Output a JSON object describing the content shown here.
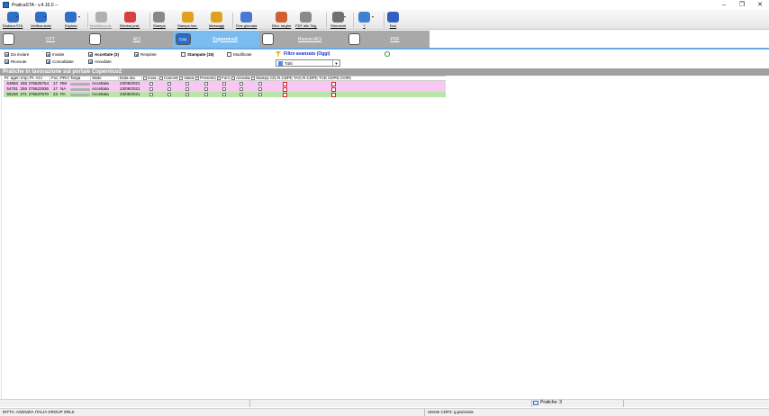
{
  "window": {
    "title": "PraticaSTA - v.4.16.0 --",
    "controls": [
      "–",
      "❐",
      "✕"
    ]
  },
  "toolbar": {
    "buttons": [
      {
        "label": "Elabora STA",
        "icon": "elabora-icon",
        "color": "#2e6fc8",
        "dropdown": true
      },
      {
        "label": "Verifica stato",
        "icon": "verifica-icon",
        "color": "#2e6fc8",
        "dropdown": true
      },
      {
        "label": "Esplora",
        "icon": "esplora-icon",
        "color": "#2e6fc8",
        "dropdown": true
      },
      {
        "label": "Modifica prat.",
        "icon": "modifica-icon",
        "color": "#b0b0b0",
        "disabled": true
      },
      {
        "label": "Elimina prat.",
        "icon": "elimina-icon",
        "color": "#d84040"
      },
      {
        "label": "Stampa",
        "icon": "stampa-icon",
        "color": "#888888"
      },
      {
        "label": "Stampa Ism.",
        "icon": "stampa-ism-icon",
        "color": "#e0a020"
      },
      {
        "label": "Messaggi",
        "icon": "messaggi-icon",
        "color": "#e0a020"
      },
      {
        "label": "Fine giornata",
        "icon": "fine-giornata-icon",
        "color": "#4a7ad0"
      },
      {
        "label": "Elim. targhe",
        "icon": "elim-targhe-icon",
        "color": "#d06030"
      },
      {
        "label": "PDF alle Tag.",
        "icon": "pdf-icon",
        "color": "#8a8a8a"
      },
      {
        "label": "Strumenti",
        "icon": "strumenti-icon",
        "color": "#707070",
        "dropdown": true
      },
      {
        "label": "?",
        "icon": "help-icon",
        "color": "#4080d0",
        "dropdown": true
      },
      {
        "label": "Esci",
        "icon": "exit-icon",
        "color": "#3060c0"
      }
    ]
  },
  "tabs": [
    {
      "label": "DTT",
      "short": "DT"
    },
    {
      "label": "ACI",
      "short": "ACI"
    },
    {
      "label": "Copernico2",
      "short": "Cop.",
      "active": true
    },
    {
      "label": "Rinnovi ACI",
      "short": "RA"
    },
    {
      "label": "PNF",
      "short": "P"
    }
  ],
  "filters": {
    "row1": [
      {
        "label": "Da inviare",
        "checked": true
      },
      {
        "label": "Inviate",
        "checked": true
      },
      {
        "label": "Accettate (3)",
        "checked": true,
        "bold": true
      },
      {
        "label": "Respinte",
        "checked": true
      },
      {
        "label": "Stampate (15)",
        "checked": false,
        "bold": true
      },
      {
        "label": "Modificate",
        "checked": false
      }
    ],
    "row2": [
      {
        "label": "Ricevute",
        "checked": true
      },
      {
        "label": "Convalidate",
        "checked": true
      },
      {
        "label": "Annullate",
        "checked": true
      }
    ],
    "advanced": "Filtro avanzato (Oggi)",
    "select_value": "Tutti"
  },
  "section_title": "Pratiche in lavorazione sul portale Copernico2",
  "grid": {
    "headers": [
      "Pr. agen",
      "Imp.",
      "Pr. ACI",
      "Fsc",
      "PRA",
      "Targa",
      "Stato",
      "Data Iav.",
      "Invia",
      "Cancella",
      "Valida",
      "Presenta",
      "Forza",
      "Annulla",
      "Stampa",
      "CDC",
      "R.CDPD",
      "TAG",
      "R.CDPD",
      "TCE",
      "CDPD",
      "CORO"
    ],
    "rows": [
      {
        "pr_agen": "53683",
        "imp": "255",
        "pr_aci": "275625764",
        "fsc": "17",
        "pra": "RM",
        "stato": "Accettata",
        "data": "23/09/2021",
        "color": "pink"
      },
      {
        "pr_agen": "54781",
        "imp": "255",
        "pr_aci": "275622936",
        "fsc": "17",
        "pra": "NA",
        "stato": "Accettata",
        "data": "23/09/2021",
        "color": "pink"
      },
      {
        "pr_agen": "55150",
        "imp": "271",
        "pr_aci": "275537570",
        "fsc": "23",
        "pra": "PA",
        "stato": "Accettata",
        "data": "23/09/2021",
        "color": "green"
      }
    ]
  },
  "status": {
    "pratiche": "Pratiche: 3",
    "ditta": "DITTA: AGENZIA ITALIA GROUP SRLS",
    "utente": "Utente CDP2: g.pazzavia"
  }
}
